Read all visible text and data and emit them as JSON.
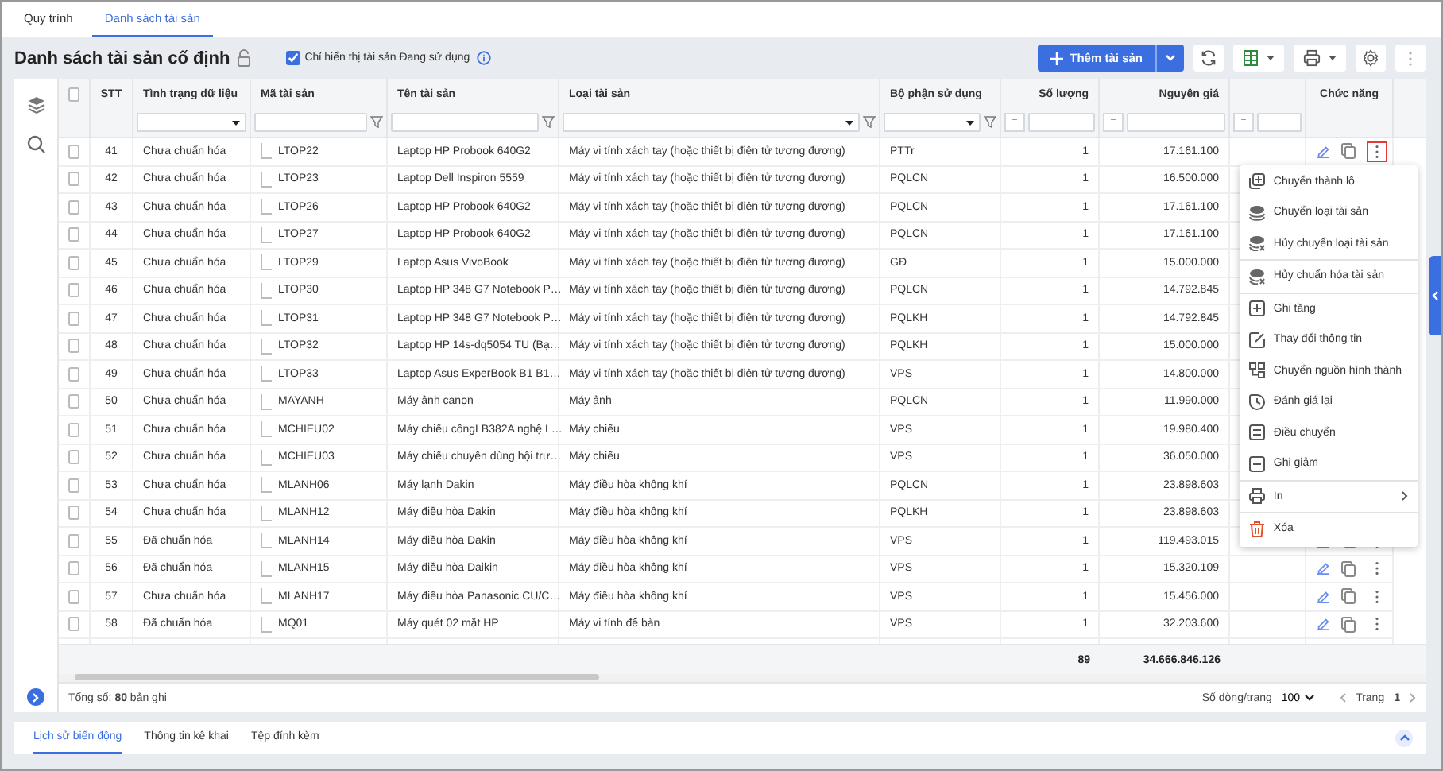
{
  "tabs": [
    {
      "label": "Quy trình",
      "selected": false
    },
    {
      "label": "Danh sách tài sản",
      "selected": true
    }
  ],
  "page_title": "Danh sách tài sản cố định",
  "in_use_filter": {
    "label": "Chỉ hiển thị tài sản Đang sử dụng",
    "checked": true
  },
  "add_button": "Thêm tài sản",
  "columns": [
    {
      "kind": "check",
      "header_checked": false
    },
    {
      "kind": "index",
      "label": "STT",
      "filter": {
        "kind": "none"
      }
    },
    {
      "kind": "text",
      "label": "Tình trạng dữ liệu",
      "filter": {
        "kind": "select"
      }
    },
    {
      "kind": "tree",
      "label": "Mã tài sản",
      "filter": {
        "kind": "text"
      }
    },
    {
      "kind": "text",
      "label": "Tên tài sản",
      "filter": {
        "kind": "text"
      }
    },
    {
      "kind": "text",
      "label": "Loại tài sản",
      "filter": {
        "kind": "select-text"
      }
    },
    {
      "kind": "text",
      "label": "Bộ phận sử dụng",
      "filter": {
        "kind": "select-text"
      }
    },
    {
      "kind": "number",
      "label": "Số lượng",
      "total": "89",
      "filter": {
        "kind": "number",
        "operator": "="
      }
    },
    {
      "kind": "number",
      "label": "Nguyên giá",
      "total": "34.666.846.126",
      "filter": {
        "kind": "number",
        "operator": "="
      }
    },
    {
      "kind": "blank",
      "filter": {
        "kind": "number",
        "operator": "="
      }
    },
    {
      "kind": "actions",
      "label": "Chức năng",
      "filter": {
        "kind": "none"
      }
    }
  ],
  "rows": [
    {
      "checked": false,
      "menu_open": true,
      "cells": [
        "41",
        "Chưa chuẩn hóa",
        "LTOP22",
        "Laptop HP Probook 640G2",
        "Máy vi tính xách tay (hoặc thiết bị điện tử tương đương)",
        "PTTr",
        "1",
        "17.161.100"
      ]
    },
    {
      "checked": false,
      "menu_open": false,
      "cells": [
        "42",
        "Chưa chuẩn hóa",
        "LTOP23",
        "Laptop Dell Inspiron 5559",
        "Máy vi tính xách tay (hoặc thiết bị điện tử tương đương)",
        "PQLCN",
        "1",
        "16.500.000"
      ]
    },
    {
      "checked": false,
      "menu_open": false,
      "cells": [
        "43",
        "Chưa chuẩn hóa",
        "LTOP26",
        "Laptop HP Probook 640G2",
        "Máy vi tính xách tay (hoặc thiết bị điện tử tương đương)",
        "PQLCN",
        "1",
        "17.161.100"
      ]
    },
    {
      "checked": false,
      "menu_open": false,
      "cells": [
        "44",
        "Chưa chuẩn hóa",
        "LTOP27",
        "Laptop HP Probook 640G2",
        "Máy vi tính xách tay (hoặc thiết bị điện tử tương đương)",
        "PQLCN",
        "1",
        "17.161.100"
      ]
    },
    {
      "checked": false,
      "menu_open": false,
      "cells": [
        "45",
        "Chưa chuẩn hóa",
        "LTOP29",
        "Laptop Asus VivoBook",
        "Máy vi tính xách tay (hoặc thiết bị điện tử tương đương)",
        "GĐ",
        "1",
        "15.000.000"
      ]
    },
    {
      "checked": false,
      "menu_open": false,
      "cells": [
        "46",
        "Chưa chuẩn hóa",
        "LTOP30",
        "Laptop HP 348 G7 Notebook P…",
        "Máy vi tính xách tay (hoặc thiết bị điện tử tương đương)",
        "PQLCN",
        "1",
        "14.792.845"
      ]
    },
    {
      "checked": false,
      "menu_open": false,
      "cells": [
        "47",
        "Chưa chuẩn hóa",
        "LTOP31",
        "Laptop HP 348 G7 Notebook P…",
        "Máy vi tính xách tay (hoặc thiết bị điện tử tương đương)",
        "PQLKH",
        "1",
        "14.792.845"
      ]
    },
    {
      "checked": false,
      "menu_open": false,
      "cells": [
        "48",
        "Chưa chuẩn hóa",
        "LTOP32",
        "Laptop HP 14s-dq5054 TU (Bạ…",
        "Máy vi tính xách tay (hoặc thiết bị điện tử tương đương)",
        "PQLKH",
        "1",
        "15.000.000"
      ]
    },
    {
      "checked": false,
      "menu_open": false,
      "cells": [
        "49",
        "Chưa chuẩn hóa",
        "LTOP33",
        "Laptop Asus ExperBook B1 B1…",
        "Máy vi tính xách tay (hoặc thiết bị điện tử tương đương)",
        "VPS",
        "1",
        "14.800.000"
      ]
    },
    {
      "checked": false,
      "menu_open": false,
      "cells": [
        "50",
        "Chưa chuẩn hóa",
        "MAYANH",
        "Máy ảnh canon",
        "Máy ảnh",
        "PQLCN",
        "1",
        "11.990.000"
      ]
    },
    {
      "checked": false,
      "menu_open": false,
      "cells": [
        "51",
        "Chưa chuẩn hóa",
        "MCHIEU02",
        "Máy chiếu côngLB382A nghệ L…",
        "Máy chiếu",
        "VPS",
        "1",
        "19.980.400"
      ]
    },
    {
      "checked": false,
      "menu_open": false,
      "cells": [
        "52",
        "Chưa chuẩn hóa",
        "MCHIEU03",
        "Máy chiếu chuyên dùng hội trư…",
        "Máy chiếu",
        "VPS",
        "1",
        "36.050.000"
      ]
    },
    {
      "checked": false,
      "menu_open": false,
      "cells": [
        "53",
        "Chưa chuẩn hóa",
        "MLANH06",
        "Máy lạnh Dakin",
        "Máy điều hòa không khí",
        "PQLCN",
        "1",
        "23.898.603"
      ]
    },
    {
      "checked": false,
      "menu_open": false,
      "cells": [
        "54",
        "Chưa chuẩn hóa",
        "MLANH12",
        "Máy điều hòa Dakin",
        "Máy điều hòa không khí",
        "PQLKH",
        "1",
        "23.898.603"
      ]
    },
    {
      "checked": false,
      "menu_open": false,
      "cells": [
        "55",
        "Đã chuẩn hóa",
        "MLANH14",
        "Máy điều hòa Dakin",
        "Máy điều hòa không khí",
        "VPS",
        "1",
        "119.493.015"
      ]
    },
    {
      "checked": false,
      "menu_open": false,
      "cells": [
        "56",
        "Đã chuẩn hóa",
        "MLANH15",
        "Máy điều hòa Daikin",
        "Máy điều hòa không khí",
        "VPS",
        "1",
        "15.320.109"
      ]
    },
    {
      "checked": false,
      "menu_open": false,
      "cells": [
        "57",
        "Chưa chuẩn hóa",
        "MLANH17",
        "Máy điều hòa Panasonic CU/C…",
        "Máy điều hòa không khí",
        "VPS",
        "1",
        "15.456.000"
      ]
    },
    {
      "checked": false,
      "menu_open": false,
      "cells": [
        "58",
        "Đã chuẩn hóa",
        "MQ01",
        "Máy quét 02 mặt HP",
        "Máy vi tính để bàn",
        "VPS",
        "1",
        "32.203.600"
      ]
    }
  ],
  "context_menu": [
    {
      "kind": "stack-plus",
      "label": "Chuyển thành lô",
      "separator": false,
      "submenu": false
    },
    {
      "kind": "layers",
      "label": "Chuyển loại tài sản",
      "separator": false,
      "submenu": false
    },
    {
      "kind": "layers-x",
      "label": "Hủy chuyển loại tài sản",
      "separator": false,
      "submenu": false
    },
    {
      "kind": "layers-x",
      "label": "Hủy chuẩn hóa tài sản",
      "separator": true,
      "submenu": false
    },
    {
      "kind": "plus",
      "label": "Ghi tăng",
      "separator": true,
      "submenu": false
    },
    {
      "kind": "edit",
      "label": "Thay đổi thông tin",
      "separator": false,
      "submenu": false
    },
    {
      "kind": "flow",
      "label": "Chuyển nguồn hình thành",
      "separator": false,
      "submenu": false
    },
    {
      "kind": "clock",
      "label": "Đánh giá lại",
      "separator": false,
      "submenu": false
    },
    {
      "kind": "transfer",
      "label": "Điều chuyển",
      "separator": false,
      "submenu": false
    },
    {
      "kind": "minus",
      "label": "Ghi giảm",
      "separator": false,
      "submenu": false
    },
    {
      "kind": "printer",
      "label": "In",
      "separator": true,
      "submenu": true
    },
    {
      "kind": "trash",
      "label": "Xóa",
      "separator": true,
      "submenu": false
    }
  ],
  "footer": {
    "total": "Tổng số: **80** bản ghi",
    "page_size_label": "Số dòng/trang",
    "page_size": "100",
    "page_label": "Trang",
    "page": "1"
  },
  "bottom_tabs": [
    {
      "label": "Lịch sử biến động",
      "selected": true
    },
    {
      "label": "Thông tin kê khai",
      "selected": false
    },
    {
      "label": "Tệp đính kèm",
      "selected": false
    }
  ]
}
